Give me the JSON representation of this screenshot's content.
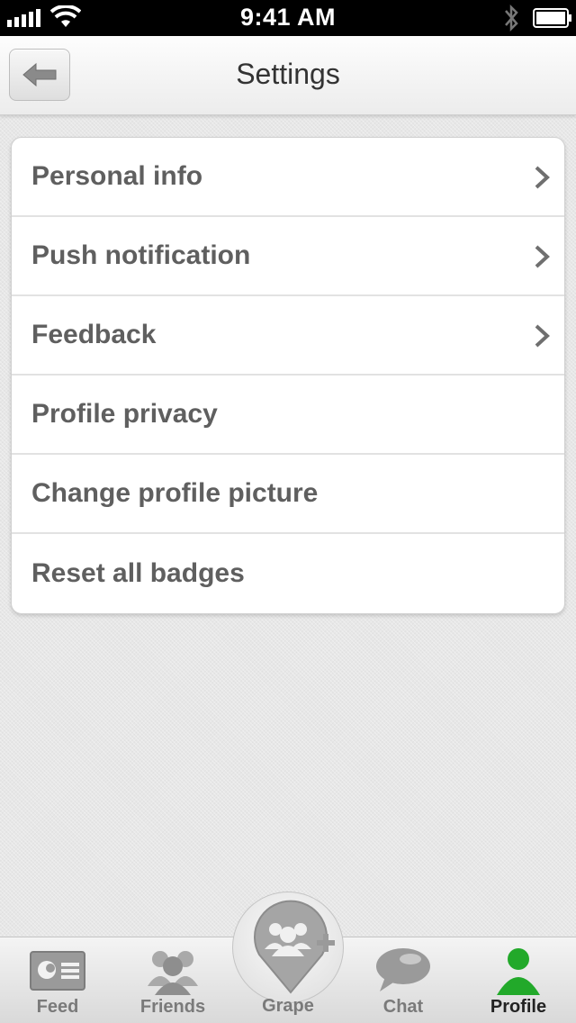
{
  "status_bar": {
    "time": "9:41 AM"
  },
  "nav_bar": {
    "title": "Settings"
  },
  "settings": {
    "items": [
      {
        "label": "Personal info",
        "has_chevron": true
      },
      {
        "label": "Push notification",
        "has_chevron": true
      },
      {
        "label": "Feedback",
        "has_chevron": true
      },
      {
        "label": "Profile privacy",
        "has_chevron": false
      },
      {
        "label": "Change profile picture",
        "has_chevron": false
      },
      {
        "label": "Reset all badges",
        "has_chevron": false
      }
    ]
  },
  "tab_bar": {
    "tabs": [
      {
        "label": "Feed",
        "icon": "feed-icon"
      },
      {
        "label": "Friends",
        "icon": "friends-icon"
      },
      {
        "label": "Grape",
        "icon": "grape-add-icon"
      },
      {
        "label": "Chat",
        "icon": "chat-icon"
      },
      {
        "label": "Profile",
        "icon": "profile-icon",
        "active": true
      }
    ]
  },
  "colors": {
    "active_tab": "#22a92a",
    "inactive_icon": "#9a9a9a",
    "row_text": "#5f5f5f"
  }
}
